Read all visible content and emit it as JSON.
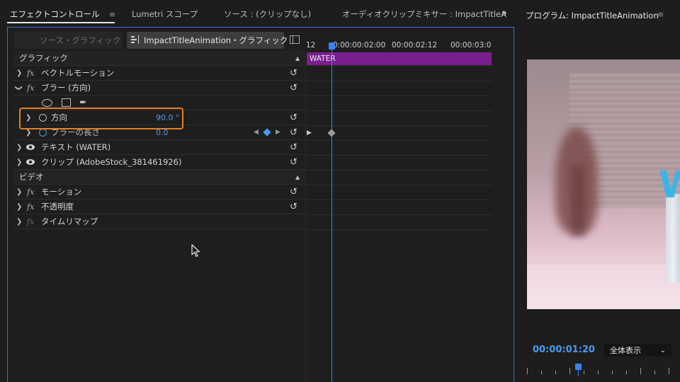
{
  "tabs": {
    "effect_controls": "エフェクトコントロール",
    "lumetri": "Lumetri スコープ",
    "source": "ソース : (クリップなし)",
    "audio_mixer": "オーディオクリップミキサー : ImpactTitleA",
    "more": "»"
  },
  "menu_glyph": "≡",
  "source_tabs": {
    "source_graphic": "ソース・グラフィック",
    "sequence_graphic": "ImpactTitleAnimation・グラフィック"
  },
  "effects": {
    "graphic_header": "グラフィック",
    "vector_motion": "ベクトルモーション",
    "blur_directional": "ブラー (方向)",
    "direction_label": "方向",
    "direction_value": "90.0 °",
    "blur_length_label": "ブラーの長さ",
    "blur_length_value": "0.0",
    "text_layer": "テキスト (WATER)",
    "clip_layer": "クリップ (AdobeStock_381461926)",
    "video_header": "ビデオ",
    "motion": "モーション",
    "opacity": "不透明度",
    "time_remap": "タイムリマップ"
  },
  "timeline": {
    "ruler_left": "12",
    "ruler_1": "0:00:00:02:00",
    "ruler_2": "00:00:02:12",
    "ruler_3": "00:00:03:0",
    "clip_label": "WATER"
  },
  "program": {
    "title": "プログラム: ImpactTitleAnimation",
    "timecode": "00:00:01:20",
    "fit_option": "全体表示",
    "overlay_text": "W"
  },
  "colors": {
    "accent_blue": "#3b82f6",
    "keyframe_blue": "#4a9af0",
    "highlight_orange": "#e67e22",
    "clip_purple": "#7b1f8e"
  }
}
